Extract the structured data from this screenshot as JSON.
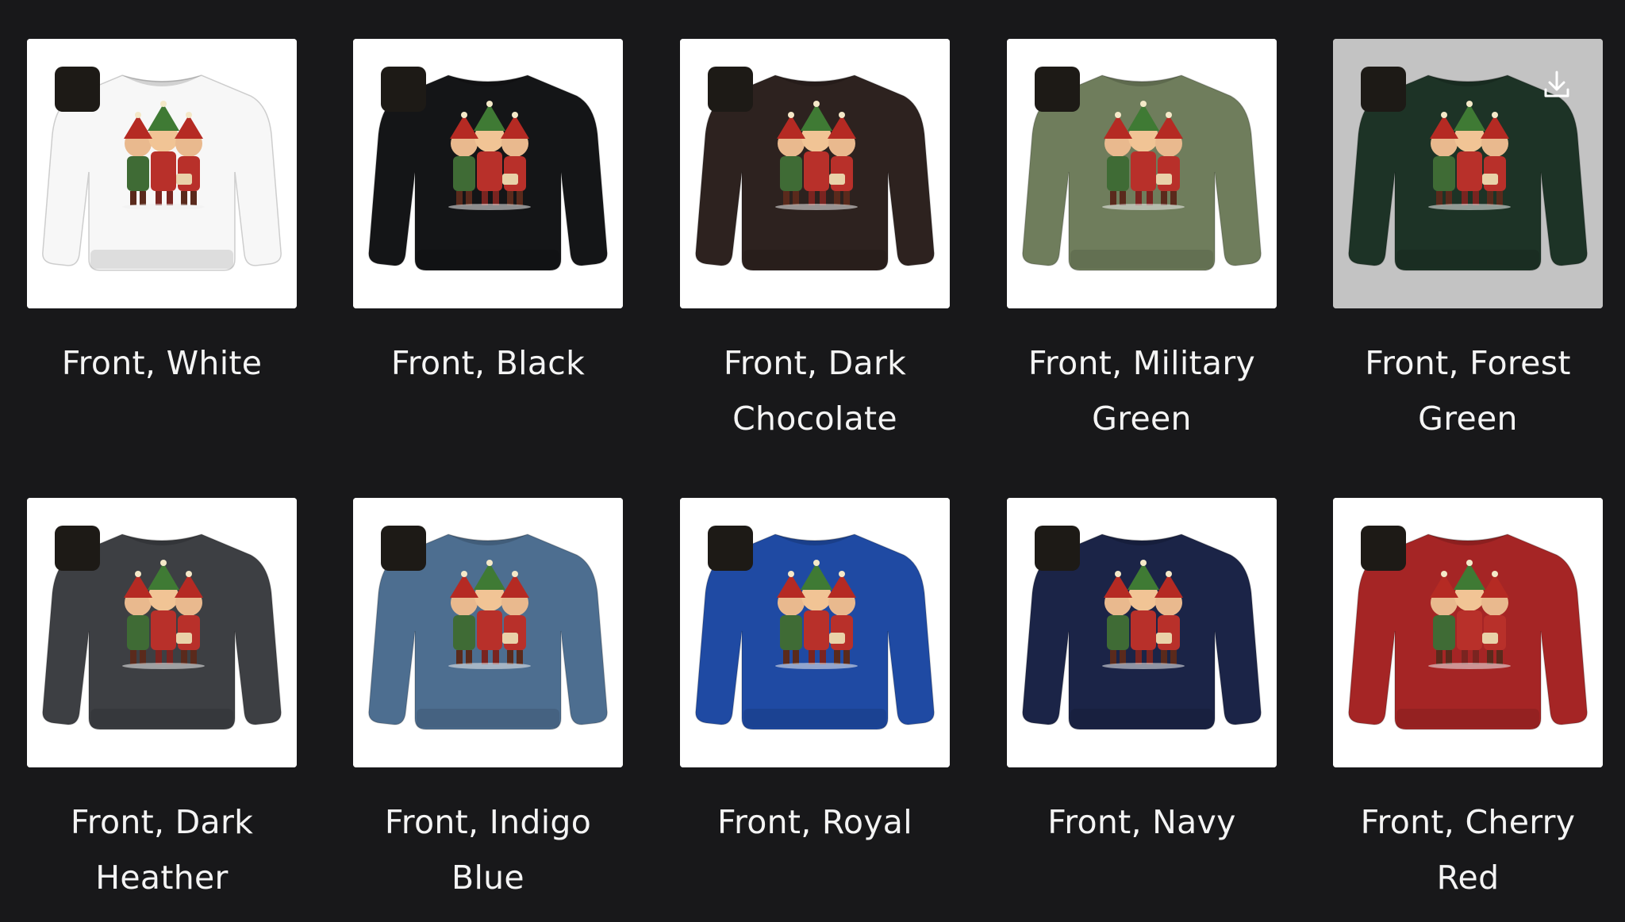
{
  "products": [
    {
      "label": "Front, White",
      "color": "#f7f7f7"
    },
    {
      "label": "Front, Black",
      "color": "#141517"
    },
    {
      "label": "Front, Dark Chocolate",
      "color": "#2d221f"
    },
    {
      "label": "Front, Military Green",
      "color": "#6f7d5c"
    },
    {
      "label": "Front, Forest Green",
      "color": "#1d3326",
      "hovered": true,
      "download_icon": "download-icon"
    },
    {
      "label": "Front, Dark Heather",
      "color": "#3d3f43"
    },
    {
      "label": "Front, Indigo Blue",
      "color": "#4d6e90"
    },
    {
      "label": "Front, Royal",
      "color": "#1f4aa3"
    },
    {
      "label": "Front, Navy",
      "color": "#1b2447"
    },
    {
      "label": "Front, Cherry Red",
      "color": "#a52525"
    }
  ]
}
